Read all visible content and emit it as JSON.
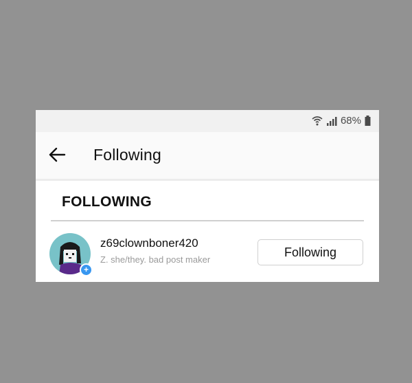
{
  "status_bar": {
    "battery_text": "68%",
    "icons": [
      "wifi-icon",
      "signal-icon",
      "battery-icon"
    ]
  },
  "app_bar": {
    "title": "Following",
    "back_icon": "arrow-left-icon"
  },
  "section": {
    "header": "FOLLOWING"
  },
  "users": [
    {
      "username": "z69clownboner420",
      "bio": "Z. she/they. bad post maker",
      "button_label": "Following",
      "badge_icon": "plus-icon"
    }
  ],
  "colors": {
    "background": "#929292",
    "avatar_bg": "#78c2c8",
    "badge": "#3897f0",
    "avatar_shirt": "#5a2a8a"
  }
}
